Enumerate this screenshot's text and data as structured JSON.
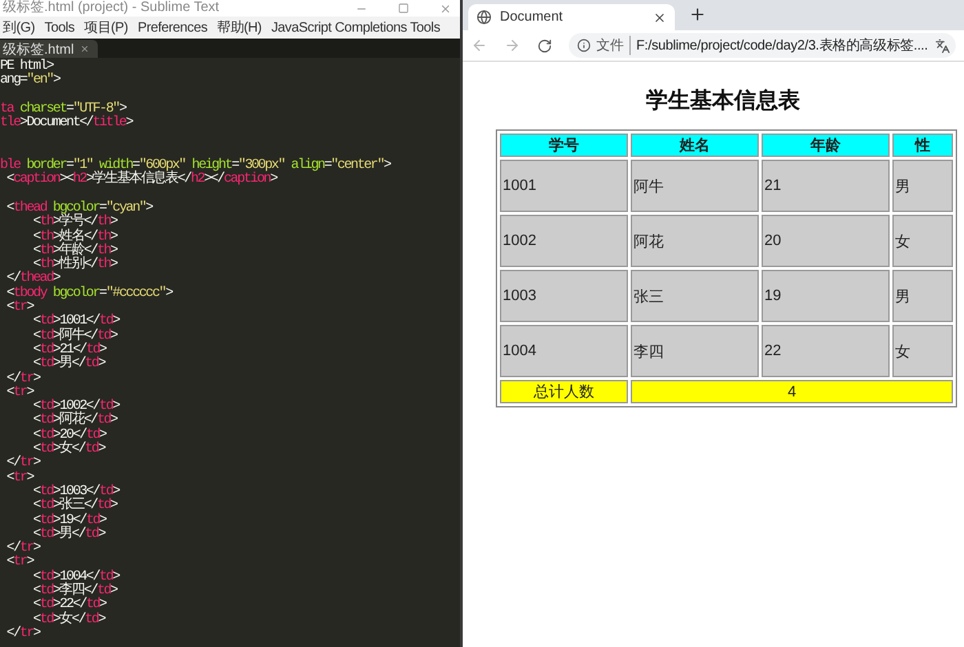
{
  "editor": {
    "window_title": "级标签.html (project) - Sublime Text",
    "menu": [
      "到(G)",
      "Tools",
      "项目(P)",
      "Preferences",
      "帮助(H)",
      "JavaScript Completions Tools"
    ],
    "tab": {
      "label": "级标签.html"
    },
    "code_lines": [
      {
        "kind": "code",
        "segments": [
          {
            "kind": "plain",
            "text": "PE html>"
          }
        ]
      },
      {
        "kind": "code",
        "segments": [
          {
            "kind": "plain",
            "text": "ang="
          },
          {
            "kind": "string",
            "text": "\"en\""
          },
          {
            "kind": "plain",
            "text": ">"
          }
        ]
      },
      {
        "kind": "blank"
      },
      {
        "kind": "code",
        "segments": [
          {
            "kind": "tag",
            "text": "ta"
          },
          {
            "kind": "attr",
            "text": " charset"
          },
          {
            "kind": "plain",
            "text": "="
          },
          {
            "kind": "string",
            "text": "\"UTF-8\""
          },
          {
            "kind": "plain",
            "text": ">"
          }
        ]
      },
      {
        "kind": "code",
        "segments": [
          {
            "kind": "tag",
            "text": "tle"
          },
          {
            "kind": "plain",
            "text": ">Document</"
          },
          {
            "kind": "tag",
            "text": "title"
          },
          {
            "kind": "plain",
            "text": ">"
          }
        ]
      },
      {
        "kind": "blank"
      },
      {
        "kind": "blank"
      },
      {
        "kind": "code",
        "segments": [
          {
            "kind": "tag",
            "text": "ble"
          },
          {
            "kind": "attr",
            "text": " border"
          },
          {
            "kind": "plain",
            "text": "="
          },
          {
            "kind": "string",
            "text": "\"1\""
          },
          {
            "kind": "attr",
            "text": " width"
          },
          {
            "kind": "plain",
            "text": "="
          },
          {
            "kind": "string",
            "text": "\"600px\""
          },
          {
            "kind": "attr",
            "text": " height"
          },
          {
            "kind": "plain",
            "text": "="
          },
          {
            "kind": "string",
            "text": "\"300px\""
          },
          {
            "kind": "attr",
            "text": " align"
          },
          {
            "kind": "plain",
            "text": "="
          },
          {
            "kind": "string",
            "text": "\"center\""
          },
          {
            "kind": "plain",
            "text": ">"
          }
        ]
      },
      {
        "kind": "code",
        "segments": [
          {
            "kind": "plain",
            "text": " <"
          },
          {
            "kind": "tag",
            "text": "caption"
          },
          {
            "kind": "plain",
            "text": "><"
          },
          {
            "kind": "tag",
            "text": "h2"
          },
          {
            "kind": "plain",
            "text": ">学生基本信息表</"
          },
          {
            "kind": "tag",
            "text": "h2"
          },
          {
            "kind": "plain",
            "text": "></"
          },
          {
            "kind": "tag",
            "text": "caption"
          },
          {
            "kind": "plain",
            "text": ">"
          }
        ]
      },
      {
        "kind": "blank"
      },
      {
        "kind": "code",
        "segments": [
          {
            "kind": "plain",
            "text": " <"
          },
          {
            "kind": "tag",
            "text": "thead"
          },
          {
            "kind": "attr",
            "text": " bgcolor"
          },
          {
            "kind": "plain",
            "text": "="
          },
          {
            "kind": "string",
            "text": "\"cyan\""
          },
          {
            "kind": "plain",
            "text": ">"
          }
        ]
      },
      {
        "kind": "code",
        "segments": [
          {
            "kind": "plain",
            "text": "     <"
          },
          {
            "kind": "tag",
            "text": "th"
          },
          {
            "kind": "plain",
            "text": ">学号</"
          },
          {
            "kind": "tag",
            "text": "th"
          },
          {
            "kind": "plain",
            "text": ">"
          }
        ]
      },
      {
        "kind": "code",
        "segments": [
          {
            "kind": "plain",
            "text": "     <"
          },
          {
            "kind": "tag",
            "text": "th"
          },
          {
            "kind": "plain",
            "text": ">姓名</"
          },
          {
            "kind": "tag",
            "text": "th"
          },
          {
            "kind": "plain",
            "text": ">"
          }
        ]
      },
      {
        "kind": "code",
        "segments": [
          {
            "kind": "plain",
            "text": "     <"
          },
          {
            "kind": "tag",
            "text": "th"
          },
          {
            "kind": "plain",
            "text": ">年龄</"
          },
          {
            "kind": "tag",
            "text": "th"
          },
          {
            "kind": "plain",
            "text": ">"
          }
        ]
      },
      {
        "kind": "code",
        "segments": [
          {
            "kind": "plain",
            "text": "     <"
          },
          {
            "kind": "tag",
            "text": "th"
          },
          {
            "kind": "plain",
            "text": ">性别</"
          },
          {
            "kind": "tag",
            "text": "th"
          },
          {
            "kind": "plain",
            "text": ">"
          }
        ]
      },
      {
        "kind": "code",
        "segments": [
          {
            "kind": "plain",
            "text": " </"
          },
          {
            "kind": "tag",
            "text": "thead"
          },
          {
            "kind": "plain",
            "text": ">"
          }
        ]
      },
      {
        "kind": "code",
        "segments": [
          {
            "kind": "plain",
            "text": " <"
          },
          {
            "kind": "tag",
            "text": "tbody"
          },
          {
            "kind": "attr",
            "text": " bgcolor"
          },
          {
            "kind": "plain",
            "text": "="
          },
          {
            "kind": "string",
            "text": "\"#cccccc\""
          },
          {
            "kind": "plain",
            "text": ">"
          }
        ]
      },
      {
        "kind": "code",
        "segments": [
          {
            "kind": "plain",
            "text": " <"
          },
          {
            "kind": "tag",
            "text": "tr"
          },
          {
            "kind": "plain",
            "text": ">"
          }
        ]
      },
      {
        "kind": "code",
        "segments": [
          {
            "kind": "plain",
            "text": "     <"
          },
          {
            "kind": "tag",
            "text": "td"
          },
          {
            "kind": "plain",
            "text": ">1001</"
          },
          {
            "kind": "tag",
            "text": "td"
          },
          {
            "kind": "plain",
            "text": ">"
          }
        ]
      },
      {
        "kind": "code",
        "segments": [
          {
            "kind": "plain",
            "text": "     <"
          },
          {
            "kind": "tag",
            "text": "td"
          },
          {
            "kind": "plain",
            "text": ">阿牛</"
          },
          {
            "kind": "tag",
            "text": "td"
          },
          {
            "kind": "plain",
            "text": ">"
          }
        ]
      },
      {
        "kind": "code",
        "segments": [
          {
            "kind": "plain",
            "text": "     <"
          },
          {
            "kind": "tag",
            "text": "td"
          },
          {
            "kind": "plain",
            "text": ">21</"
          },
          {
            "kind": "tag",
            "text": "td"
          },
          {
            "kind": "plain",
            "text": ">"
          }
        ]
      },
      {
        "kind": "code",
        "segments": [
          {
            "kind": "plain",
            "text": "     <"
          },
          {
            "kind": "tag",
            "text": "td"
          },
          {
            "kind": "plain",
            "text": ">男</"
          },
          {
            "kind": "tag",
            "text": "td"
          },
          {
            "kind": "plain",
            "text": ">"
          }
        ]
      },
      {
        "kind": "code",
        "segments": [
          {
            "kind": "plain",
            "text": " </"
          },
          {
            "kind": "tag",
            "text": "tr"
          },
          {
            "kind": "plain",
            "text": ">"
          }
        ]
      },
      {
        "kind": "code",
        "segments": [
          {
            "kind": "plain",
            "text": " <"
          },
          {
            "kind": "tag",
            "text": "tr"
          },
          {
            "kind": "plain",
            "text": ">"
          }
        ]
      },
      {
        "kind": "code",
        "segments": [
          {
            "kind": "plain",
            "text": "     <"
          },
          {
            "kind": "tag",
            "text": "td"
          },
          {
            "kind": "plain",
            "text": ">1002</"
          },
          {
            "kind": "tag",
            "text": "td"
          },
          {
            "kind": "plain",
            "text": ">"
          }
        ]
      },
      {
        "kind": "code",
        "segments": [
          {
            "kind": "plain",
            "text": "     <"
          },
          {
            "kind": "tag",
            "text": "td"
          },
          {
            "kind": "plain",
            "text": ">阿花</"
          },
          {
            "kind": "tag",
            "text": "td"
          },
          {
            "kind": "plain",
            "text": ">"
          }
        ]
      },
      {
        "kind": "code",
        "segments": [
          {
            "kind": "plain",
            "text": "     <"
          },
          {
            "kind": "tag",
            "text": "td"
          },
          {
            "kind": "plain",
            "text": ">20</"
          },
          {
            "kind": "tag",
            "text": "td"
          },
          {
            "kind": "plain",
            "text": ">"
          }
        ]
      },
      {
        "kind": "code",
        "segments": [
          {
            "kind": "plain",
            "text": "     <"
          },
          {
            "kind": "tag",
            "text": "td"
          },
          {
            "kind": "plain",
            "text": ">女</"
          },
          {
            "kind": "tag",
            "text": "td"
          },
          {
            "kind": "plain",
            "text": ">"
          }
        ]
      },
      {
        "kind": "code",
        "segments": [
          {
            "kind": "plain",
            "text": " </"
          },
          {
            "kind": "tag",
            "text": "tr"
          },
          {
            "kind": "plain",
            "text": ">"
          }
        ]
      },
      {
        "kind": "code",
        "segments": [
          {
            "kind": "plain",
            "text": " <"
          },
          {
            "kind": "tag",
            "text": "tr"
          },
          {
            "kind": "plain",
            "text": ">"
          }
        ]
      },
      {
        "kind": "code",
        "segments": [
          {
            "kind": "plain",
            "text": "     <"
          },
          {
            "kind": "tag",
            "text": "td"
          },
          {
            "kind": "plain",
            "text": ">1003</"
          },
          {
            "kind": "tag",
            "text": "td"
          },
          {
            "kind": "plain",
            "text": ">"
          }
        ]
      },
      {
        "kind": "code",
        "segments": [
          {
            "kind": "plain",
            "text": "     <"
          },
          {
            "kind": "tag",
            "text": "td"
          },
          {
            "kind": "plain",
            "text": ">张三</"
          },
          {
            "kind": "tag",
            "text": "td"
          },
          {
            "kind": "plain",
            "text": ">"
          }
        ]
      },
      {
        "kind": "code",
        "segments": [
          {
            "kind": "plain",
            "text": "     <"
          },
          {
            "kind": "tag",
            "text": "td"
          },
          {
            "kind": "plain",
            "text": ">19</"
          },
          {
            "kind": "tag",
            "text": "td"
          },
          {
            "kind": "plain",
            "text": ">"
          }
        ]
      },
      {
        "kind": "code",
        "segments": [
          {
            "kind": "plain",
            "text": "     <"
          },
          {
            "kind": "tag",
            "text": "td"
          },
          {
            "kind": "plain",
            "text": ">男</"
          },
          {
            "kind": "tag",
            "text": "td"
          },
          {
            "kind": "plain",
            "text": ">"
          }
        ]
      },
      {
        "kind": "code",
        "segments": [
          {
            "kind": "plain",
            "text": " </"
          },
          {
            "kind": "tag",
            "text": "tr"
          },
          {
            "kind": "plain",
            "text": ">"
          }
        ]
      },
      {
        "kind": "code",
        "segments": [
          {
            "kind": "plain",
            "text": " <"
          },
          {
            "kind": "tag",
            "text": "tr"
          },
          {
            "kind": "plain",
            "text": ">"
          }
        ]
      },
      {
        "kind": "code",
        "segments": [
          {
            "kind": "plain",
            "text": "     <"
          },
          {
            "kind": "tag",
            "text": "td"
          },
          {
            "kind": "plain",
            "text": ">1004</"
          },
          {
            "kind": "tag",
            "text": "td"
          },
          {
            "kind": "plain",
            "text": ">"
          }
        ]
      },
      {
        "kind": "code",
        "segments": [
          {
            "kind": "plain",
            "text": "     <"
          },
          {
            "kind": "tag",
            "text": "td"
          },
          {
            "kind": "plain",
            "text": ">李四</"
          },
          {
            "kind": "tag",
            "text": "td"
          },
          {
            "kind": "plain",
            "text": ">"
          }
        ]
      },
      {
        "kind": "code",
        "segments": [
          {
            "kind": "plain",
            "text": "     <"
          },
          {
            "kind": "tag",
            "text": "td"
          },
          {
            "kind": "plain",
            "text": ">22</"
          },
          {
            "kind": "tag",
            "text": "td"
          },
          {
            "kind": "plain",
            "text": ">"
          }
        ]
      },
      {
        "kind": "code",
        "segments": [
          {
            "kind": "plain",
            "text": "     <"
          },
          {
            "kind": "tag",
            "text": "td"
          },
          {
            "kind": "plain",
            "text": ">女</"
          },
          {
            "kind": "tag",
            "text": "td"
          },
          {
            "kind": "plain",
            "text": ">"
          }
        ]
      },
      {
        "kind": "code",
        "segments": [
          {
            "kind": "plain",
            "text": " </"
          },
          {
            "kind": "tag",
            "text": "tr"
          },
          {
            "kind": "plain",
            "text": ">"
          }
        ]
      }
    ]
  },
  "browser": {
    "tab": {
      "title": "Document"
    },
    "address": {
      "scheme_label": "文件",
      "url": "F:/sublime/project/code/day2/3.表格的高级标签...."
    },
    "page": {
      "caption": "学生基本信息表",
      "table": {
        "columns": [
          "学号",
          "姓名",
          "年龄",
          "性"
        ],
        "rows": [
          [
            "1001",
            "阿牛",
            "21",
            "男"
          ],
          [
            "1002",
            "阿花",
            "20",
            "女"
          ],
          [
            "1003",
            "张三",
            "19",
            "男"
          ],
          [
            "1004",
            "李四",
            "22",
            "女"
          ]
        ],
        "footer": {
          "label": "总计人数",
          "value": "4"
        }
      }
    }
  }
}
